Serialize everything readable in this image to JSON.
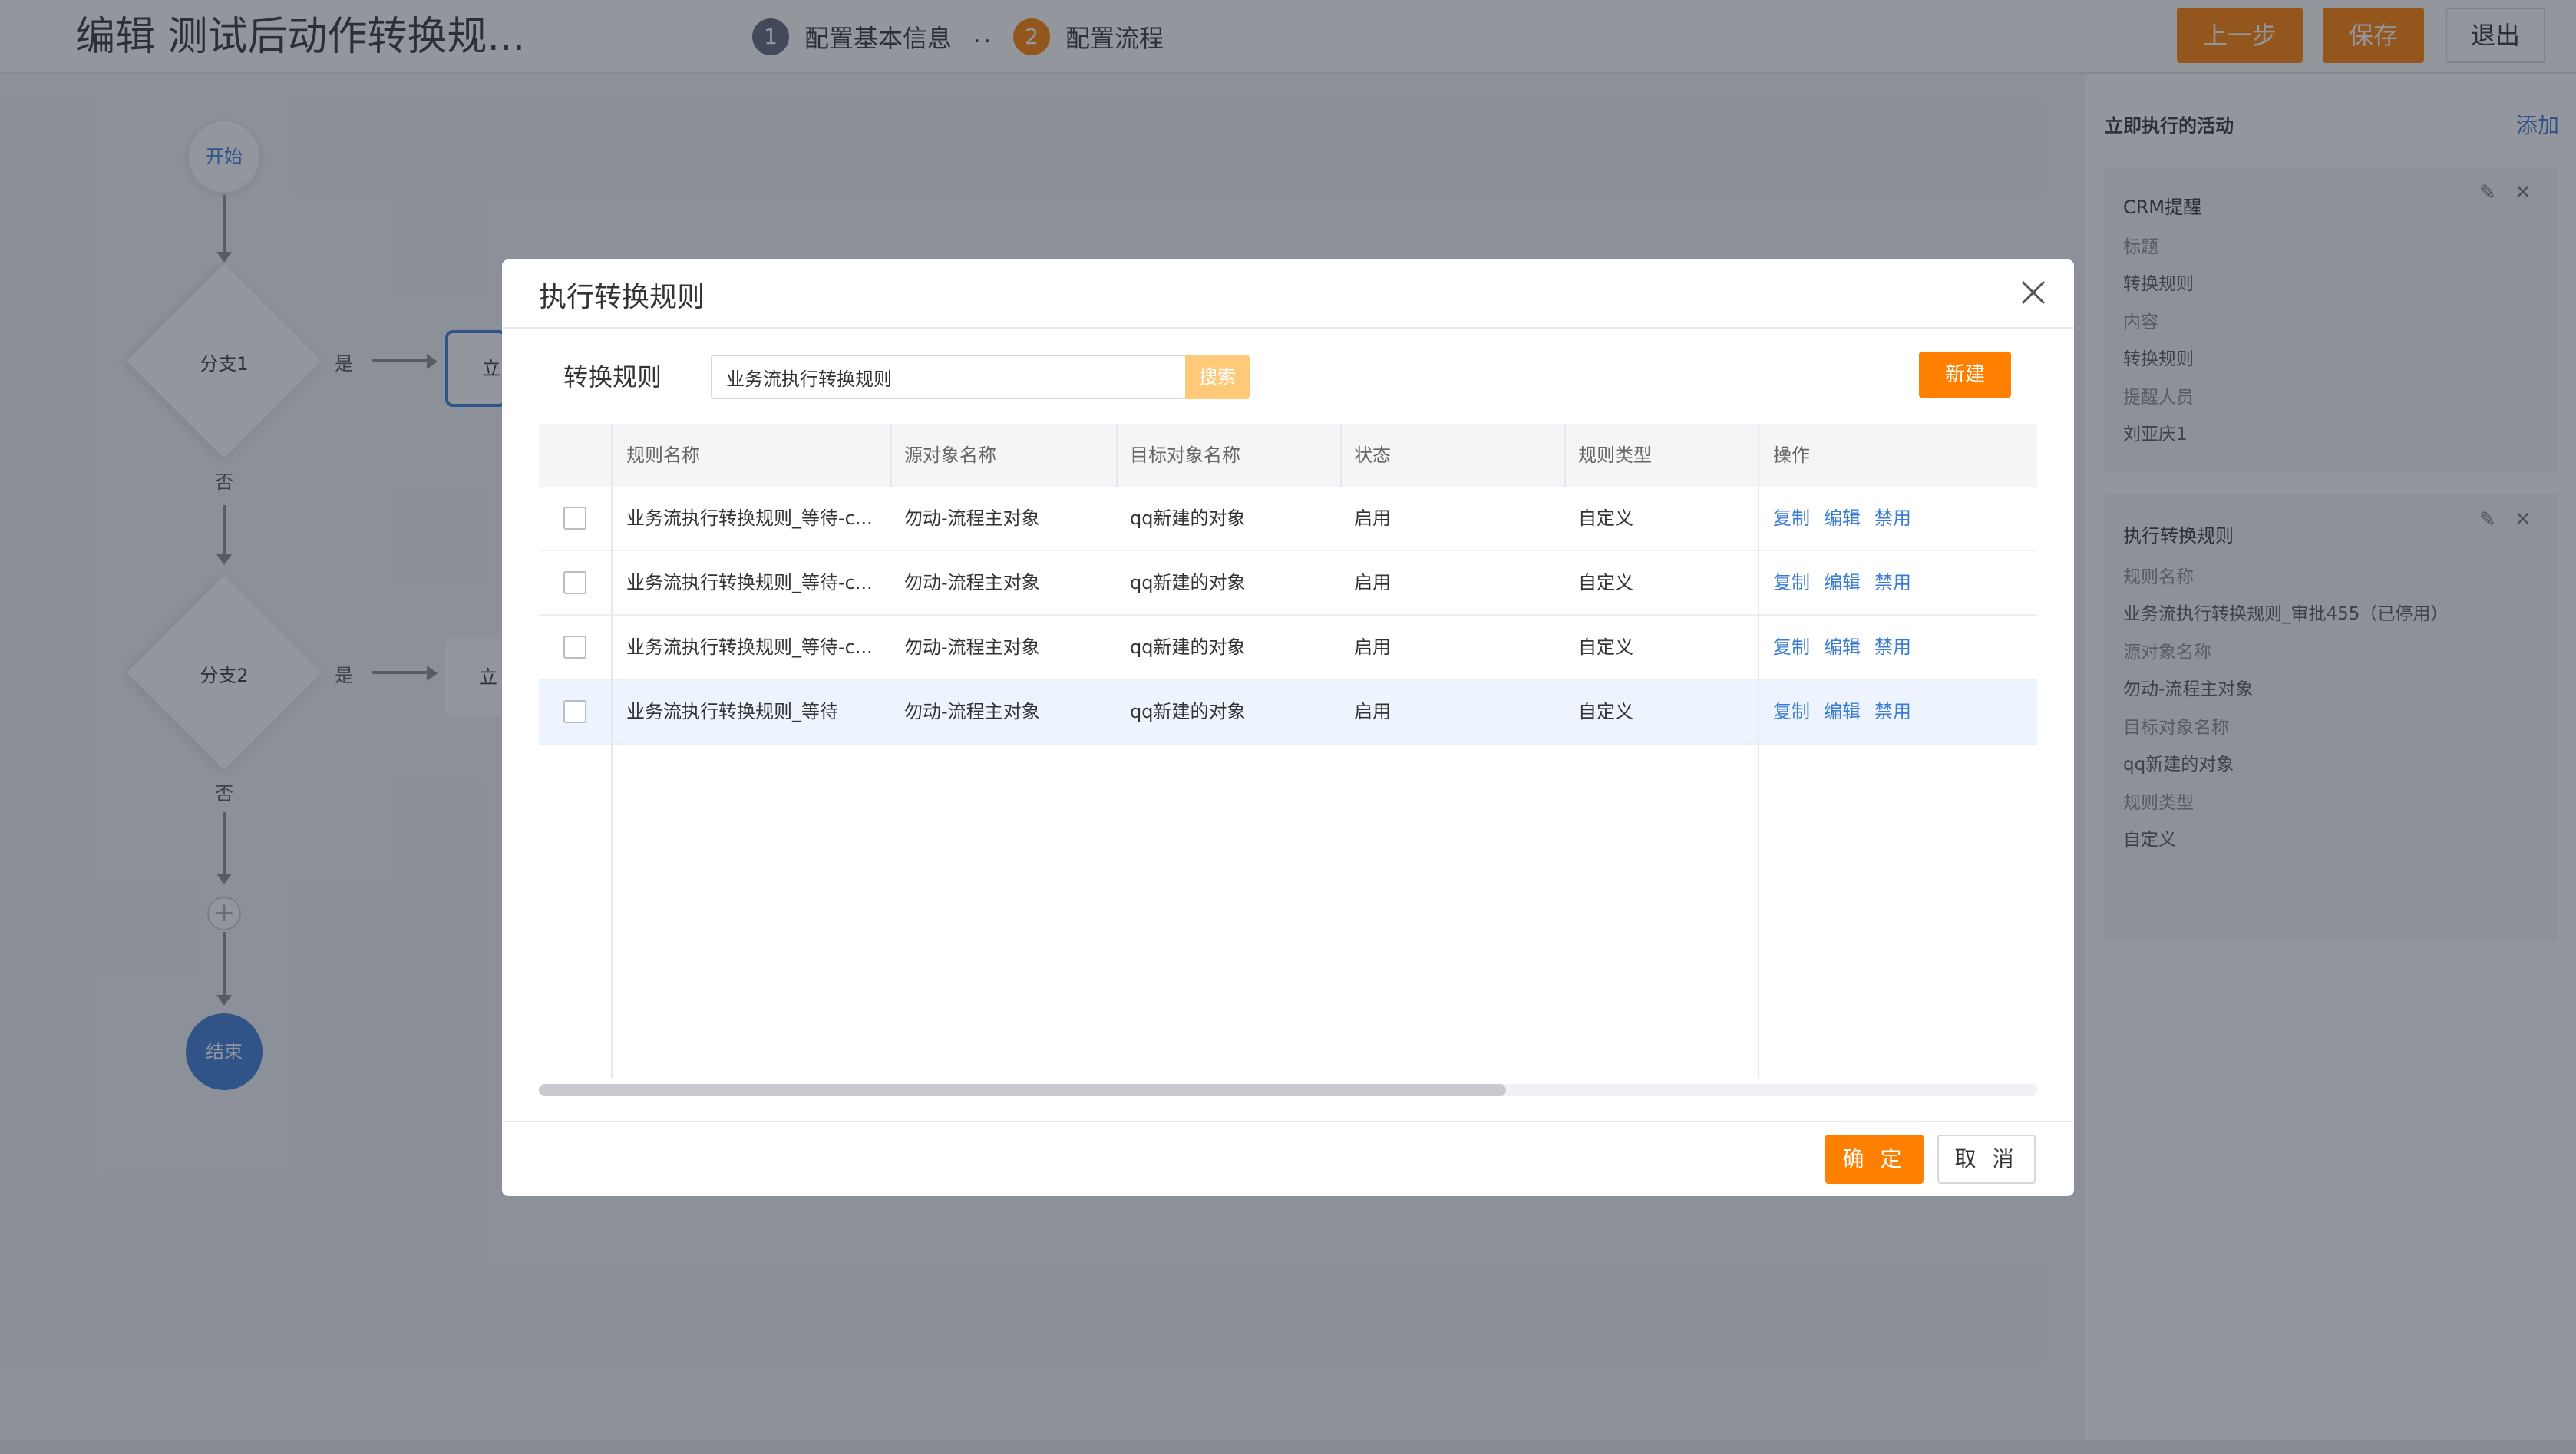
{
  "header": {
    "title": "编辑 测试后动作转换规...",
    "steps": [
      {
        "num": "1",
        "label": "配置基本信息"
      },
      {
        "num": "2",
        "label": "配置流程"
      }
    ],
    "dots": "..",
    "buttons": {
      "prev": "上一步",
      "save": "保存",
      "exit": "退出"
    }
  },
  "flow": {
    "start": "开始",
    "branch1": "分支1",
    "branch2": "分支2",
    "yes": "是",
    "no": "否",
    "action": "立",
    "add": "+",
    "end": "结束"
  },
  "right_panel": {
    "title": "立即执行的活动",
    "add": "添加",
    "cards": [
      {
        "title": "CRM提醒",
        "lines": [
          {
            "text": "标题",
            "kind": "key"
          },
          {
            "text": "转换规则",
            "kind": "value"
          },
          {
            "text": "内容",
            "kind": "key"
          },
          {
            "text": "转换规则",
            "kind": "value"
          },
          {
            "text": "提醒人员",
            "kind": "key"
          },
          {
            "text": "刘亚庆1",
            "kind": "value"
          }
        ]
      },
      {
        "title": "执行转换规则",
        "lines": [
          {
            "text": "规则名称",
            "kind": "key"
          },
          {
            "text": "业务流执行转换规则_审批455（已停用）",
            "kind": "value"
          },
          {
            "text": "源对象名称",
            "kind": "key"
          },
          {
            "text": "勿动-流程主对象",
            "kind": "value"
          },
          {
            "text": "目标对象名称",
            "kind": "key"
          },
          {
            "text": "qq新建的对象",
            "kind": "value"
          },
          {
            "text": "规则类型",
            "kind": "key"
          },
          {
            "text": "自定义",
            "kind": "value"
          }
        ]
      }
    ]
  },
  "modal": {
    "title": "执行转换规则",
    "filter_label": "转换规则",
    "search_value": "业务流执行转换规则",
    "search_button": "搜索",
    "new_button": "新建",
    "columns": [
      "规则名称",
      "源对象名称",
      "目标对象名称",
      "状态",
      "规则类型",
      "操作"
    ],
    "rows": [
      {
        "name": "业务流执行转换规则_等待-c...",
        "source": "勿动-流程主对象",
        "target": "qq新建的对象",
        "status": "启用",
        "type": "自定义",
        "ops": [
          "复制",
          "编辑",
          "禁用"
        ]
      },
      {
        "name": "业务流执行转换规则_等待-c...",
        "source": "勿动-流程主对象",
        "target": "qq新建的对象",
        "status": "启用",
        "type": "自定义",
        "ops": [
          "复制",
          "编辑",
          "禁用"
        ]
      },
      {
        "name": "业务流执行转换规则_等待-c...",
        "source": "勿动-流程主对象",
        "target": "qq新建的对象",
        "status": "启用",
        "type": "自定义",
        "ops": [
          "复制",
          "编辑",
          "禁用"
        ]
      },
      {
        "name": "业务流执行转换规则_等待",
        "source": "勿动-流程主对象",
        "target": "qq新建的对象",
        "status": "启用",
        "type": "自定义",
        "ops": [
          "复制",
          "编辑",
          "禁用"
        ]
      }
    ],
    "highlighted_row": 3,
    "ok_button": "确 定",
    "cancel_button": "取 消"
  },
  "colors": {
    "accent": "#ff8000",
    "link": "#3a7bd5",
    "step1": "#5c6478",
    "step2": "#ff8000"
  },
  "icons": {
    "close": "close-icon",
    "edit": "pencil-icon",
    "remove": "close-icon"
  }
}
